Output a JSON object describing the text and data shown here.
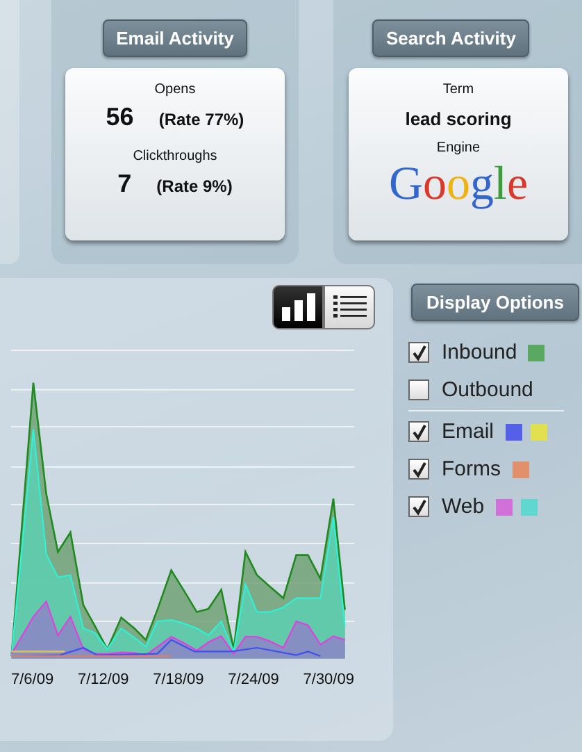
{
  "email_activity": {
    "title": "Email Activity",
    "metrics": [
      {
        "name": "Opens",
        "count": "56",
        "rate": "(Rate 77%)"
      },
      {
        "name": "Clickthroughs",
        "count": "7",
        "rate": "(Rate 9%)"
      }
    ]
  },
  "search_activity": {
    "title": "Search Activity",
    "term_label": "Term",
    "term": "lead scoring",
    "engine_label": "Engine",
    "engine_logo": "Google"
  },
  "chart": {
    "view_buttons": [
      {
        "kind": "chart",
        "selected": true
      },
      {
        "kind": "list",
        "selected": false
      }
    ],
    "x_labels": [
      "7/6/09",
      "7/12/09",
      "7/18/09",
      "7/24/09",
      "7/30/09"
    ]
  },
  "display_options": {
    "title": "Display Options",
    "groups": [
      [
        {
          "label": "Inbound",
          "checked": true,
          "swatches": [
            {
              "color": "#5aa862"
            }
          ]
        },
        {
          "label": "Outbound",
          "checked": false
        }
      ],
      [
        {
          "label": "Email",
          "checked": true,
          "swatches": [
            {
              "color": "#5560e8"
            },
            {
              "color": "#e0e050"
            }
          ]
        },
        {
          "label": "Forms",
          "checked": true,
          "swatches": [
            {
              "color": "#e0906a"
            }
          ]
        },
        {
          "label": "Web",
          "checked": true,
          "swatches": [
            {
              "color": "#d070d8"
            },
            {
              "color": "#60d8d0"
            }
          ]
        }
      ]
    ]
  }
}
